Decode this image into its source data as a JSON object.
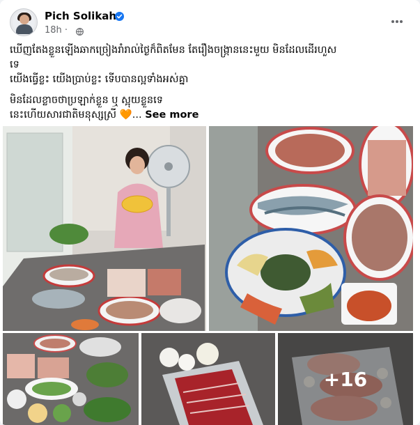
{
  "post": {
    "author": "Pich Solikah",
    "time": "18h",
    "separator": "·",
    "privacy_icon": "globe-icon",
    "verified_icon": "verified-badge-icon",
    "more_icon": "more-options-icon",
    "text_lines": [
      "ឃើញតែងខ្លួនឡើងឆាកច្រៀងរាំរាល់ថ្ងៃក៏ពិតមែន តែរឿងចង្រ្កាននេះមួយ មិនដែលដើរហួស",
      "ទេ",
      "យើងធ្វើខ្លះ យើងប្រាប់ខ្លះ ទើបបានល្អទាំងអស់គ្នា"
    ],
    "text_lines_2": [
      "មិនដែលខ្លាចថាប្រឡាក់ខ្លួន ឬ ស្អុយខ្លួនទេ",
      "នេះហើយសារជាតិមនុស្សស្រី"
    ],
    "heart_emoji": "🧡",
    "ellipsis": "...",
    "see_more": "See more",
    "more_photos_count": "+16"
  },
  "colors": {
    "text": "#050505",
    "secondary": "#65676b",
    "verified": "#1877f2",
    "background": "#ffffff"
  }
}
